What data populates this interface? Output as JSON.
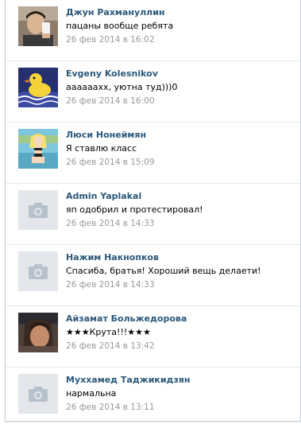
{
  "comments": [
    {
      "author": "Джун Рахмануллин",
      "text": "пацаны вообще ребята",
      "date": "26 фев 2014 в 16:02"
    },
    {
      "author": "Evgeny Kolesnikov",
      "text": "аааааахх, уютна туд)))0",
      "date": "26 фев 2014 в 16:00"
    },
    {
      "author": "Люси Нонеймян",
      "text": "Я ставлю класс",
      "date": "26 фев 2014 в 15:09"
    },
    {
      "author": "Admin Yaplakal",
      "text": "яп одобрил и протестировал!",
      "date": "26 фев 2014 в 14:33"
    },
    {
      "author": "Нажим Накнопков",
      "text": "Спасиба, братья! Хороший вещь делаети!",
      "date": "26 фев 2014 в 14:33"
    },
    {
      "author": "Айзамат Больжедорова",
      "text": "★★★Крута!!!★★★",
      "date": "26 фев 2014 в 13:42"
    },
    {
      "author": "Мухxамед Таджикидзян",
      "text": "нармальна",
      "date": "26 фев 2014 в 13:11"
    }
  ],
  "colors": {
    "author_link": "#2b587a",
    "date": "#999999",
    "divider": "#e6e9ed",
    "placeholder_bg": "#e3e7ec",
    "camera_icon": "#b7c1cc"
  },
  "avatars": [
    "photo",
    "rubber-duck-icon",
    "cartoon-girl-photo",
    "camera-icon",
    "camera-icon",
    "photo",
    "camera-icon"
  ]
}
